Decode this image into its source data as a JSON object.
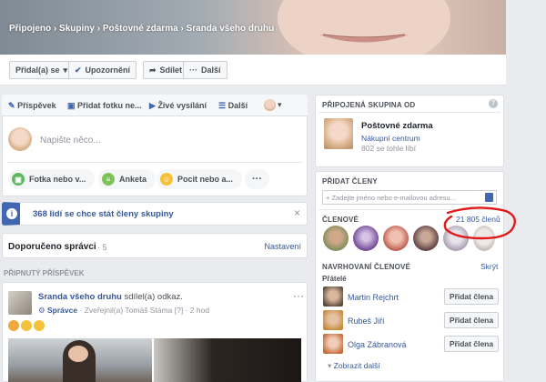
{
  "cover": {
    "breadcrumb": {
      "level_1": "Připojeno",
      "sep_1": "›",
      "level_2": "Skupiny",
      "sep_2": "›",
      "level_3": "Poštovné zdarma",
      "sep_3": "›",
      "level_4": "Sranda všeho druhu"
    }
  },
  "actions": {
    "joined": "Přidal(a) se",
    "notifications": "Upozornění",
    "share": "Sdílet",
    "more": "Další"
  },
  "composer": {
    "tabs": [
      "Příspěvek",
      "Přidat fotku ne...",
      "Živé vysílání",
      "Další"
    ],
    "placeholder": "Napište něco...",
    "chips": [
      "Fotka nebo v...",
      "Anketa",
      "Pocit nebo a..."
    ]
  },
  "notice": {
    "text": "368 lidí se chce stát členy skupiny",
    "close": "×"
  },
  "recommended": {
    "title": "Doporučeno správci",
    "count": "· 5",
    "settings": "Nastavení"
  },
  "pinned": {
    "header": "PŘIPNUTÝ PŘÍSPĚVEK",
    "author": "Sranda všeho druhu",
    "action": "sdílel(a) odkaz.",
    "role": "Správce",
    "published_by": "Zveřejnil(a) Tomáš Stáma [?]",
    "time": "2 hod",
    "menu": "···"
  },
  "linked": {
    "header": "PŘIPOJENÁ SKUPINA OD",
    "help": "?",
    "name": "Poštovné zdarma",
    "category": "Nákupní centrum",
    "likes": "802 se tohle líbí"
  },
  "add_members": {
    "header": "PŘIDAT ČLENY",
    "placeholder": "+ Zadejte jméno nebo e-mailovou adresu..."
  },
  "members": {
    "header": "ČLENOVÉ",
    "count": "21 805 členů",
    "suggested_header": "NAVRHOVANÍ ČLENOVÉ",
    "hide": "Skrýt",
    "friends_label": "Přátelé",
    "suggestions": [
      {
        "name": "Martin Rejchrt",
        "button": "Přidat člena"
      },
      {
        "name": "Rubeš Jiří",
        "button": "Přidat člena"
      },
      {
        "name": "Olga Zábranová",
        "button": "Přidat člena"
      }
    ],
    "show_more": "Zobrazit další"
  },
  "colors": {
    "fb_blue": "#4267b2",
    "link": "#365899",
    "annotation_red": "#e0191a"
  }
}
